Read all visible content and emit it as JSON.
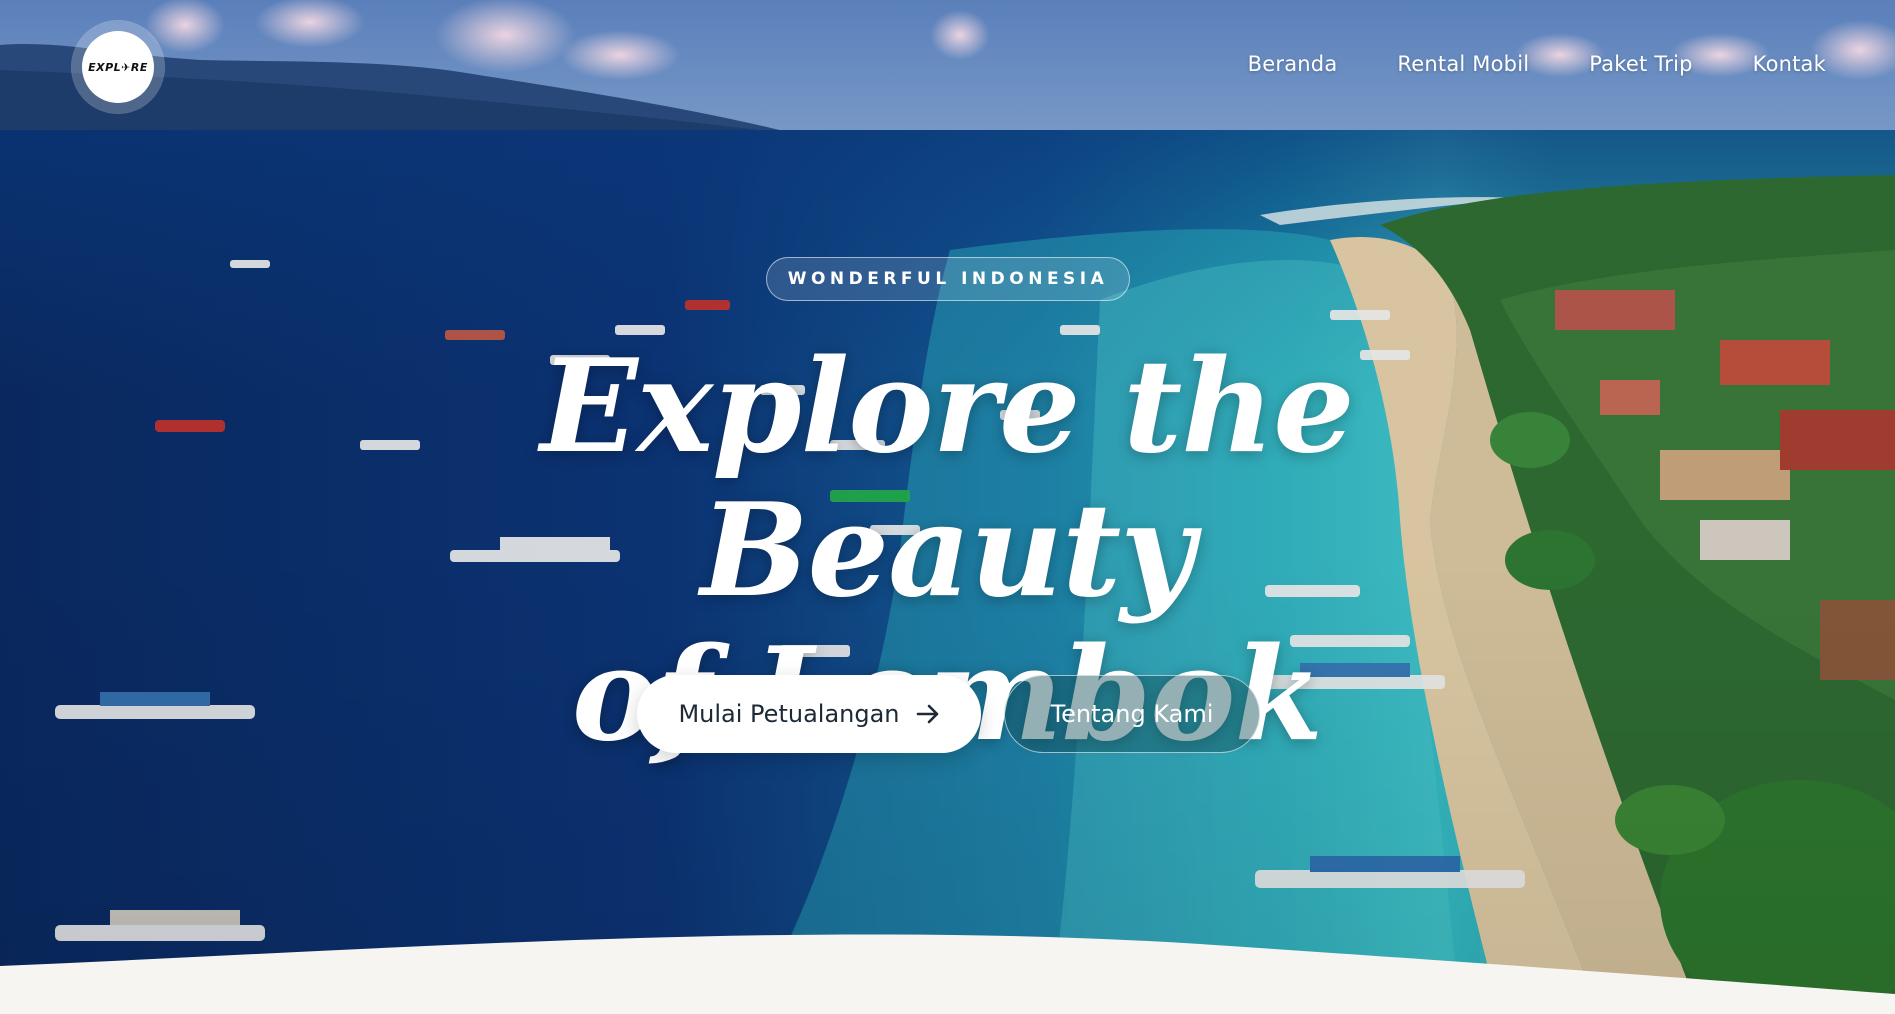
{
  "brand": {
    "logo_text": "EXPL✈RE",
    "logo_icon": "plane-icon"
  },
  "nav": {
    "items": [
      {
        "label": "Beranda"
      },
      {
        "label": "Rental Mobil"
      },
      {
        "label": "Paket Trip"
      },
      {
        "label": "Kontak"
      }
    ]
  },
  "hero": {
    "badge": "WONDERFUL INDONESIA",
    "headline_line1": "Explore the Beauty",
    "headline_line2": "of Lombok",
    "primary_button": "Mulai Petualangan",
    "primary_button_icon": "arrow-right-icon",
    "secondary_button": "Tentang Kami"
  },
  "colors": {
    "sea_deep": "#0b2f6b",
    "sea_turquoise": "#2fb3c0",
    "sand": "#e3cfa8",
    "page_bg": "#f7f5f1",
    "button_text": "#1d2a36"
  }
}
